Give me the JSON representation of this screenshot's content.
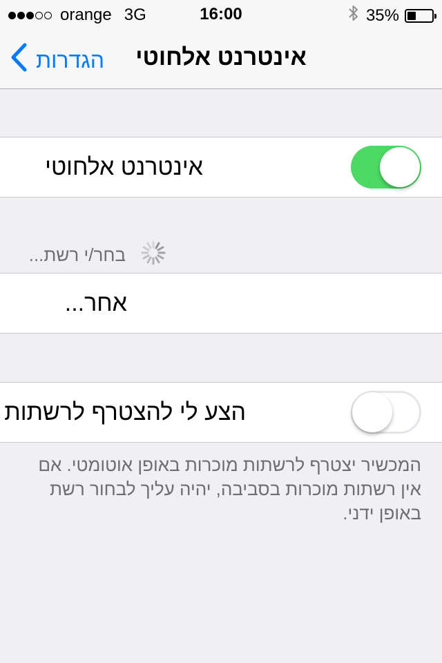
{
  "status_bar": {
    "signal_filled": 3,
    "signal_total": 5,
    "carrier": "orange",
    "network": "3G",
    "time": "16:00",
    "bluetooth_icon": "bluetooth-icon",
    "battery_text": "35%",
    "battery_level": 0.35
  },
  "nav": {
    "back_label": "הגדרות",
    "title": "אינטרנט אלחוטי"
  },
  "wifi": {
    "label": "אינטרנט אלחוטי",
    "enabled": true
  },
  "networks": {
    "header": "בחר/י רשת...",
    "other_label": "אחר..."
  },
  "ask_join": {
    "label": "הצע לי להצטרף לרשתות",
    "enabled": false,
    "footer_lines": [
      "המכשיר יצטרף לרשתות מוכרות באופן אוטומטי. אם",
      "אין רשתות מוכרות בסביבה, יהיה עליך לבחור רשת",
      "באופן ידני."
    ]
  },
  "colors": {
    "accent": "#007aff",
    "toggle_on": "#4cd964",
    "background": "#efeff4"
  }
}
